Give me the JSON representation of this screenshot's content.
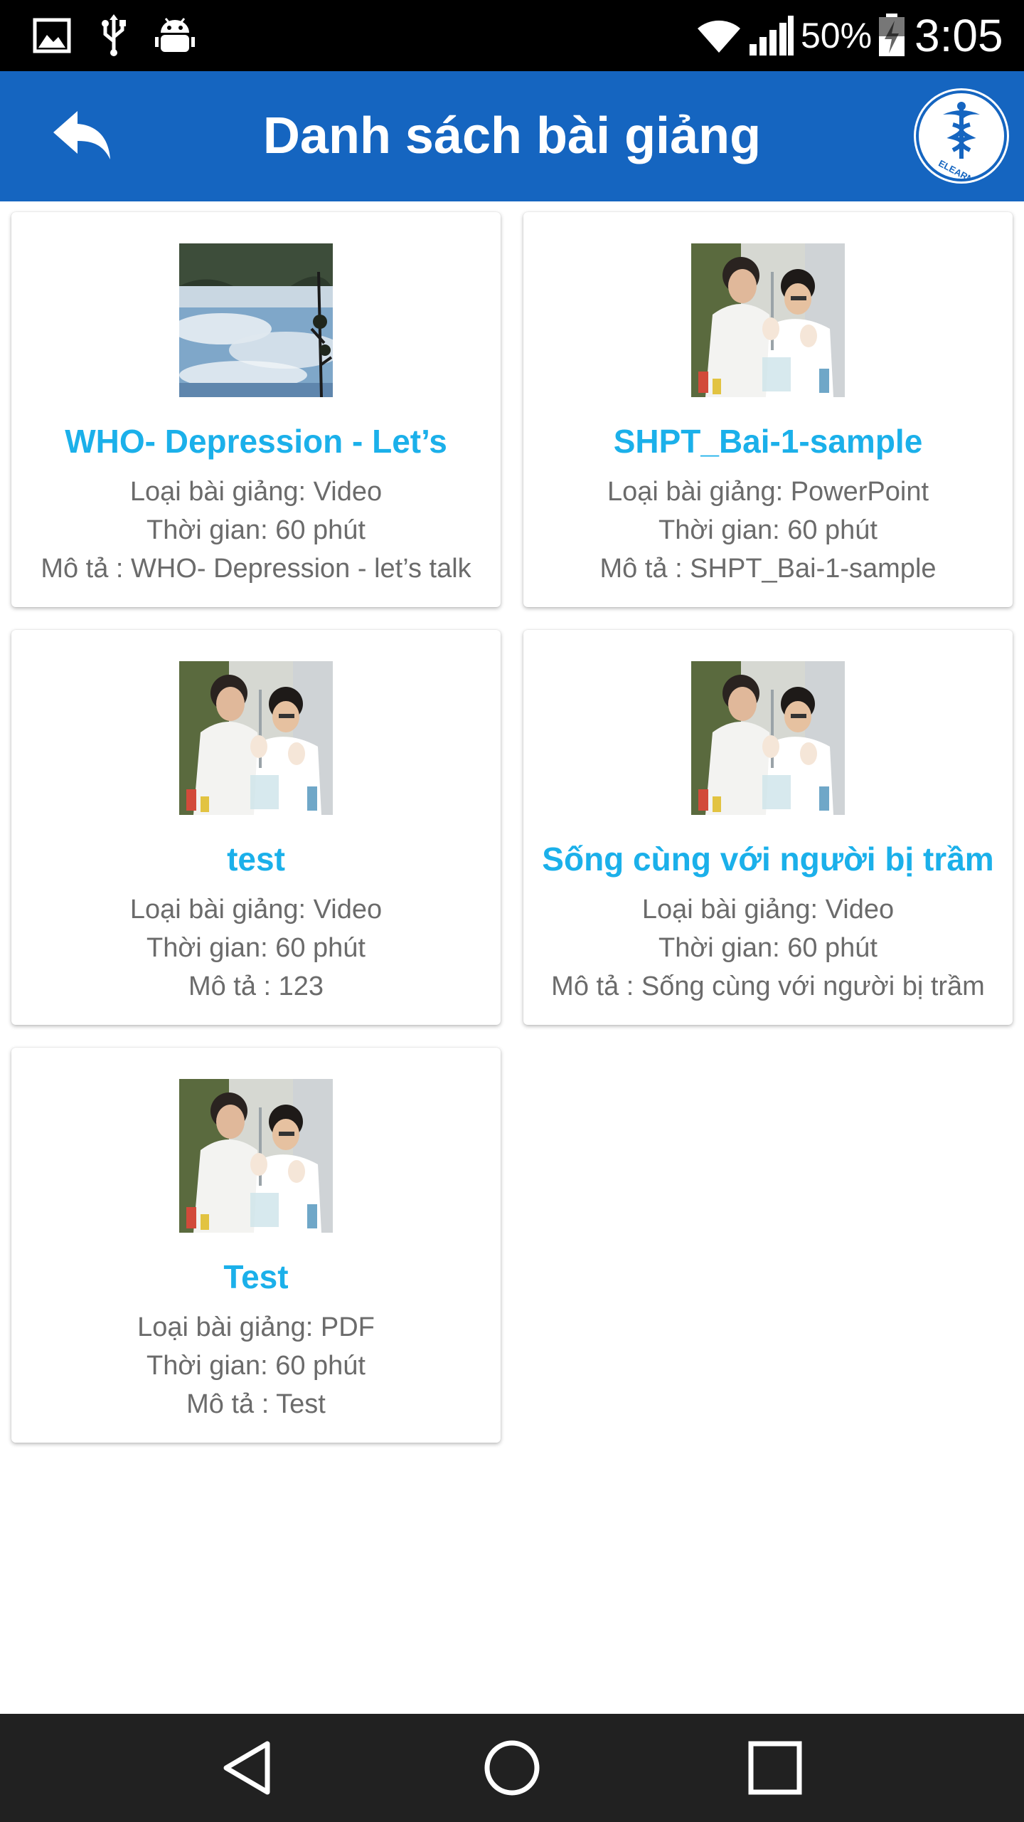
{
  "status_bar": {
    "battery_percent": "50%",
    "time": "3:05"
  },
  "app_bar": {
    "title": "Danh sách bài giảng",
    "logo_text": "ELEARNING"
  },
  "lectures": [
    {
      "title": "WHO- Depression - Let’s",
      "type_line": "Loại bài giảng: Video",
      "time_line": "Thời gian: 60 phút",
      "desc_line": "Mô tả : WHO- Depression - let’s talk",
      "thumbnail": "landscape-reflection"
    },
    {
      "title": "SHPT_Bai-1-sample",
      "type_line": "Loại bài giảng: PowerPoint",
      "time_line": "Thời gian: 60 phút",
      "desc_line": "Mô tả : SHPT_Bai-1-sample",
      "thumbnail": "lab-scientists"
    },
    {
      "title": "test",
      "type_line": "Loại bài giảng: Video",
      "time_line": "Thời gian: 60 phút",
      "desc_line": "Mô tả : 123",
      "thumbnail": "lab-scientists"
    },
    {
      "title": "Sống cùng với người bị trầm",
      "type_line": "Loại bài giảng: Video",
      "time_line": "Thời gian: 60 phút",
      "desc_line": "Mô tả : Sống cùng với người bị trầm",
      "thumbnail": "lab-scientists"
    },
    {
      "title": "Test",
      "type_line": "Loại bài giảng: PDF",
      "time_line": "Thời gian: 60 phút",
      "desc_line": "Mô tả : Test",
      "thumbnail": "lab-scientists"
    }
  ],
  "colors": {
    "app_bar": "#1565c0",
    "title_accent": "#1bb0ea",
    "body_text": "#6b6b6b",
    "status_bar": "#000000",
    "nav_bar": "#212121"
  },
  "icons": {
    "status_left": [
      "gallery-icon",
      "usb-icon",
      "android-debug-icon"
    ],
    "status_right": [
      "wifi-icon",
      "signal-icon",
      "battery-charging-icon"
    ],
    "nav": [
      "back-triangle-icon",
      "home-circle-icon",
      "recents-square-icon"
    ]
  }
}
